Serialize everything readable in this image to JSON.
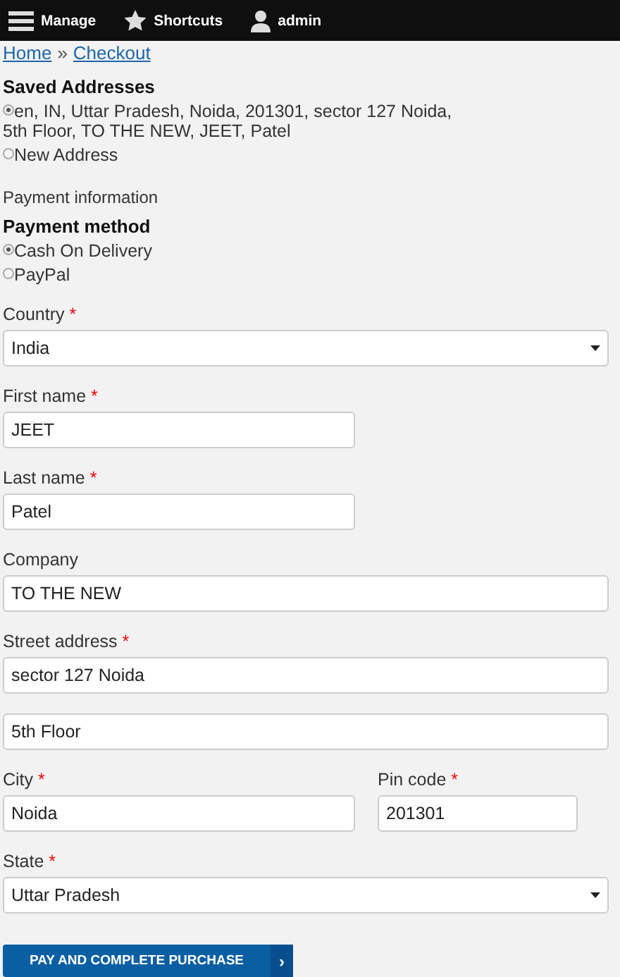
{
  "toolbar": {
    "items": [
      {
        "kind": "menu",
        "label": "Manage"
      },
      {
        "kind": "star",
        "label": "Shortcuts"
      },
      {
        "kind": "user",
        "label": "admin"
      }
    ]
  },
  "breadcrumb": [
    {
      "label": "Home"
    },
    {
      "label": "Checkout"
    }
  ],
  "breadcrumb_separator": "»",
  "required_mark": "*",
  "saved_addresses": {
    "title": "Saved Addresses",
    "options": [
      {
        "label": "en, IN, Uttar Pradesh, Noida, 201301, sector 127 Noida, 5th Floor, TO THE NEW, JEET, Patel",
        "selected": true
      },
      {
        "label": "New Address",
        "selected": false
      }
    ]
  },
  "payment_information": "Payment information",
  "payment_method": {
    "title": "Payment method",
    "options": [
      {
        "label": "Cash On Delivery",
        "selected": true
      },
      {
        "label": "PayPal",
        "selected": false
      }
    ]
  },
  "field_rows": [
    [
      {
        "kind": "select",
        "label": "Country",
        "required": true,
        "value": "India"
      }
    ],
    [
      {
        "kind": "text",
        "label": "First name",
        "required": true,
        "value": "JEET"
      }
    ],
    [
      {
        "kind": "text",
        "label": "Last name",
        "required": true,
        "value": "Patel"
      }
    ],
    [
      {
        "kind": "text",
        "label": "Company",
        "required": false,
        "value": "TO THE NEW"
      }
    ],
    [
      {
        "kind": "text",
        "label": "Street address",
        "required": true,
        "value": "sector 127 Noida"
      }
    ],
    [
      {
        "kind": "text",
        "value": "5th Floor"
      }
    ],
    [
      {
        "kind": "text",
        "label": "City",
        "required": true,
        "value": "Noida"
      },
      {
        "kind": "text",
        "label": "Pin code",
        "required": true,
        "value": "201301"
      }
    ],
    [
      {
        "kind": "select",
        "label": "State",
        "required": true,
        "value": "Uttar Pradesh"
      }
    ]
  ],
  "submit": {
    "label": "PAY AND COMPLETE PURCHASE",
    "arrow": "›"
  }
}
